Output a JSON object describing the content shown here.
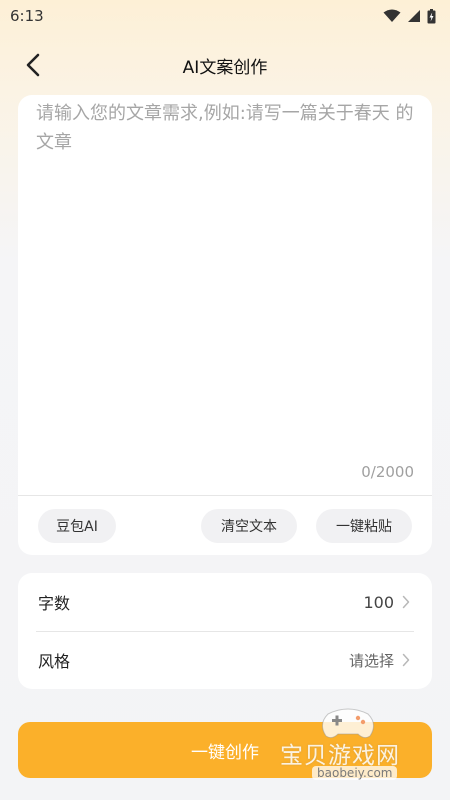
{
  "status_bar": {
    "time": "6:13"
  },
  "header": {
    "title": "AI文案创作"
  },
  "editor": {
    "placeholder": "请输入您的文章需求,例如:请写一篇关于春天 的文章",
    "value": "",
    "char_count": "0/2000",
    "chips": {
      "doubao": "豆包AI",
      "clear": "清空文本",
      "paste": "一键粘贴"
    }
  },
  "settings": {
    "word_count": {
      "label": "字数",
      "value": "100"
    },
    "style": {
      "label": "风格",
      "value": "请选择"
    }
  },
  "create_button": {
    "label": "一键创作"
  },
  "watermark": {
    "text": "宝贝游戏网",
    "domain": "baobeiy.com"
  },
  "colors": {
    "accent": "#fbb02a",
    "card": "#ffffff",
    "chip": "#f1f1f3"
  },
  "icons": {
    "back": "chevron-left-icon",
    "wifi": "wifi-icon",
    "signal": "signal-icon",
    "battery": "battery-icon",
    "chevron": "chevron-right-icon"
  }
}
